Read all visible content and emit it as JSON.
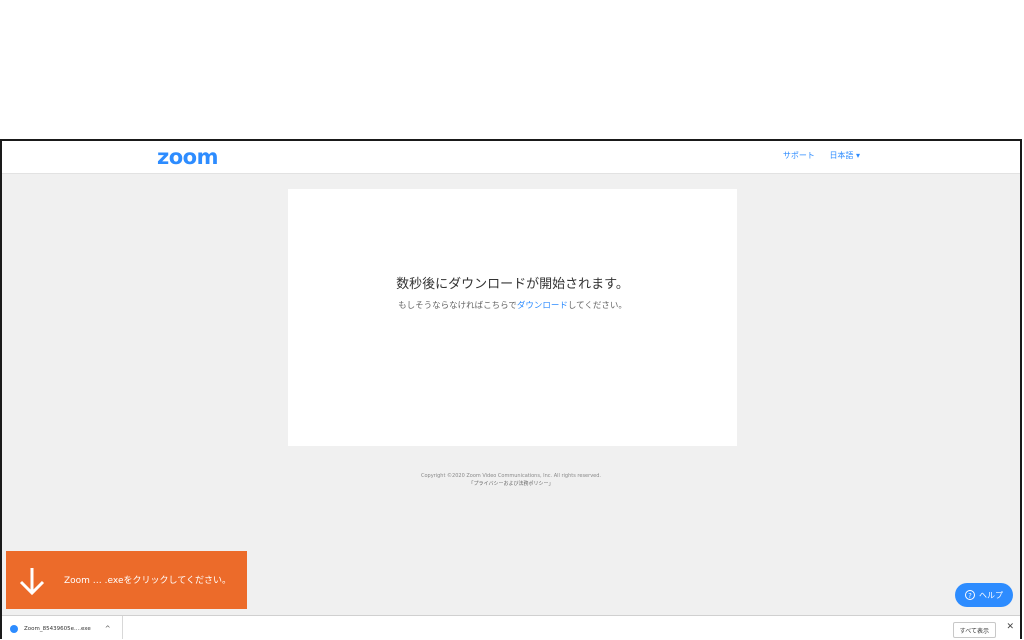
{
  "header": {
    "logo": "zoom",
    "nav": {
      "support": "サポート",
      "language": "日本語 ▾"
    }
  },
  "main": {
    "headline": "数秒後にダウンロードが開始されます。",
    "sub_prefix": "もしそうならなければこちらで",
    "sub_link": "ダウンロード",
    "sub_suffix": "してください。"
  },
  "footer": {
    "copyright": "Copyright ©2020 Zoom Video Communications, Inc. All rights reserved.",
    "privacy": "「プライバシーおよび法務ポリシー」"
  },
  "toast": {
    "message": "Zoom … .exeをクリックしてください。",
    "icon": "down-arrow-icon",
    "color": "#ec6b2a"
  },
  "help_button": {
    "label": "ヘルプ",
    "icon": "question-icon",
    "color": "#2d8cff"
  },
  "download_bar": {
    "file_name": "Zoom_85439605e....exe",
    "chevron": "^",
    "show_all": "すべて表示",
    "close": "✕"
  },
  "accent": "#2d8cff"
}
